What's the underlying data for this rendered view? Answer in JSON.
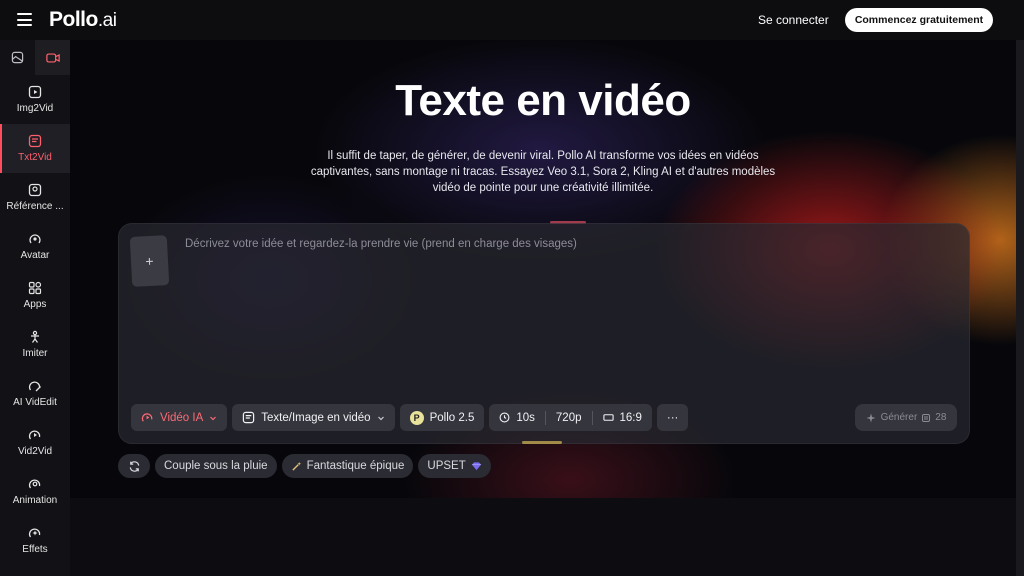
{
  "topbar": {
    "logo_main": "Pollo",
    "logo_suffix": ".ai",
    "signin_label": "Se connecter",
    "cta_label": "Commencez gratuitement"
  },
  "sidebar": {
    "items": [
      {
        "label": "Img2Vid",
        "icon": "image-video-icon"
      },
      {
        "label": "Txt2Vid",
        "icon": "text-video-icon",
        "active": true
      },
      {
        "label": "Référence ...",
        "icon": "reference-icon"
      },
      {
        "label": "Avatar",
        "icon": "avatar-icon"
      },
      {
        "label": "Apps",
        "icon": "apps-icon"
      },
      {
        "label": "Imiter",
        "icon": "imitate-icon"
      },
      {
        "label": "AI VidEdit",
        "icon": "video-edit-icon"
      },
      {
        "label": "Vid2Vid",
        "icon": "video-to-video-icon"
      },
      {
        "label": "Animation",
        "icon": "animation-icon"
      },
      {
        "label": "Effets",
        "icon": "effects-icon"
      }
    ]
  },
  "hero": {
    "title": "Texte en vidéo",
    "subtitle": "Il suffit de taper, de générer, de devenir viral. Pollo AI transforme vos idées en vidéos captivantes, sans montage ni tracas. Essayez Veo 3.1, Sora 2, Kling AI et d'autres modèles vidéo de pointe pour une créativité illimitée."
  },
  "editor": {
    "upload_glyph": "+",
    "prompt_placeholder": "Décrivez votre idée et regardez-la prendre vie (prend en charge des visages)",
    "mode_label": "Vidéo IA",
    "input_type_label": "Texte/Image en vidéo",
    "model_label": "Pollo 2.5",
    "duration": "10s",
    "resolution": "720p",
    "aspect_ratio": "16:9",
    "more_glyph": "···",
    "generate_label": "Générer",
    "credits": "28"
  },
  "suggestions": [
    {
      "label": "Couple sous la pluie"
    },
    {
      "label": "Fantastique épique"
    },
    {
      "label": "UPSET"
    }
  ],
  "colors": {
    "accent_red": "#ff5f6d",
    "cta_bg": "#ffffff",
    "panel_bg": "#2a2a32"
  }
}
